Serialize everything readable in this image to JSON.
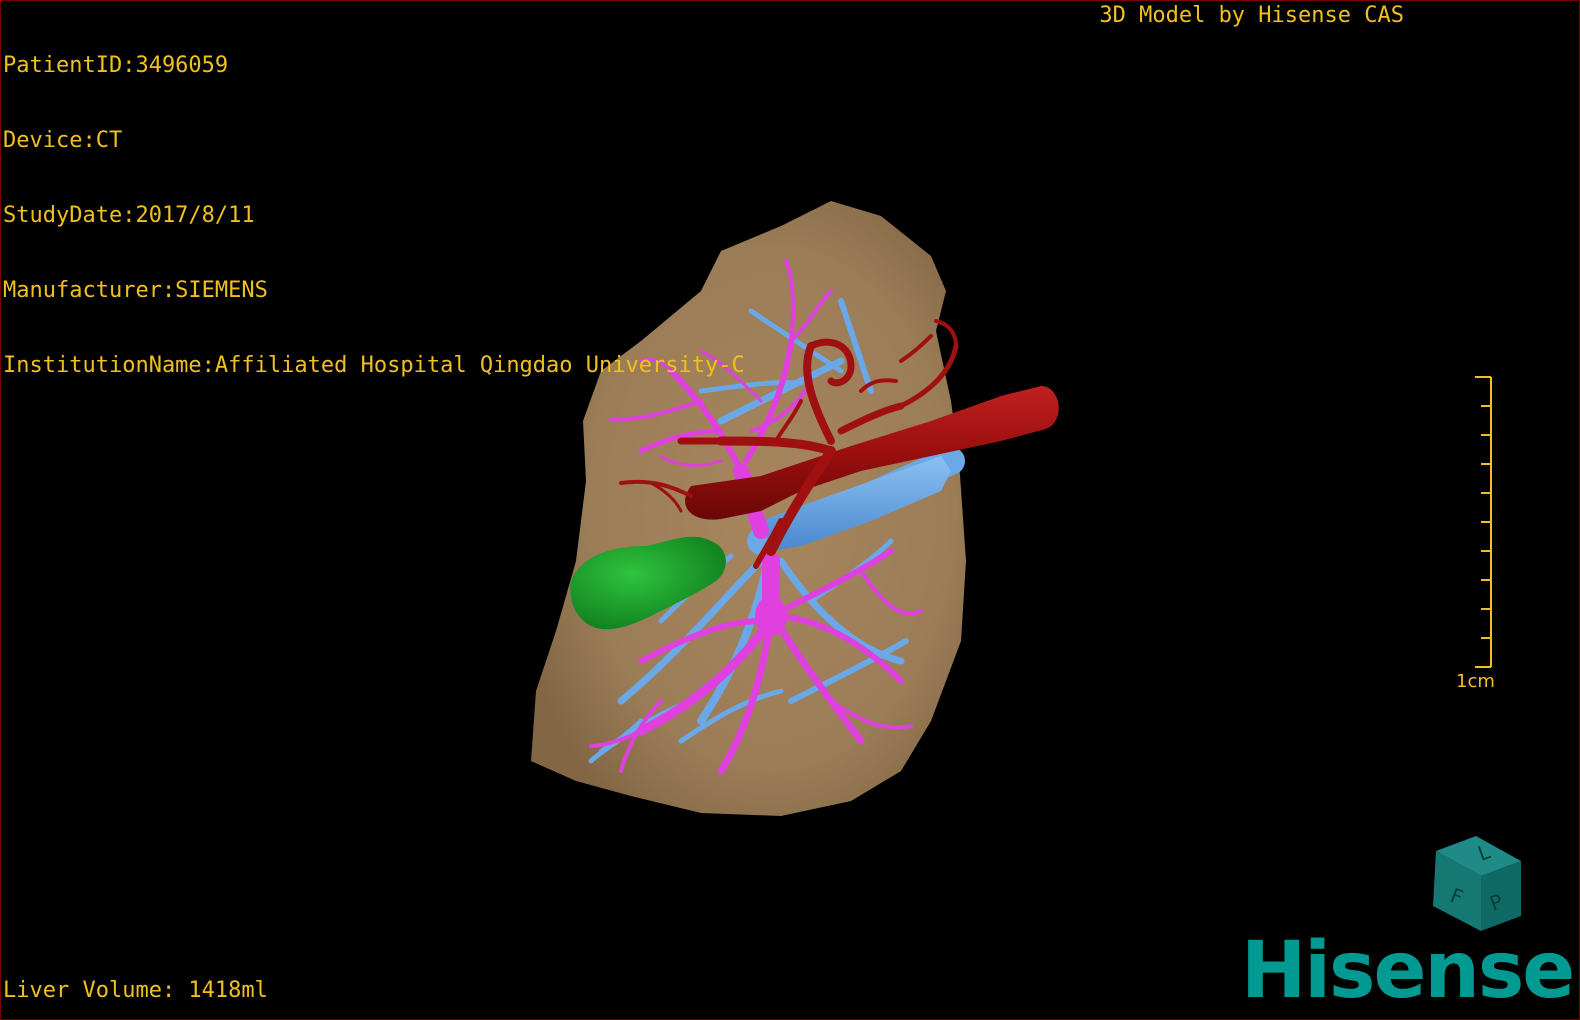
{
  "header": {
    "patient_id": "PatientID:3496059",
    "device": "Device:CT",
    "study_date": "StudyDate:2017/8/11",
    "manufacturer": "Manufacturer:SIEMENS",
    "institution": "InstitutionName:Affiliated Hospital Qingdao University-C"
  },
  "title": "3D Model by Hisense CAS",
  "footer": {
    "liver_volume": "Liver Volume: 1418ml"
  },
  "scale": {
    "label": "1cm"
  },
  "orientation_cube": {
    "face_left": "F",
    "face_right": "P",
    "face_top": "L"
  },
  "brand": {
    "logo_text": "Hisense"
  },
  "colors": {
    "overlay_text": "#f0c020",
    "liver": "#a3835c",
    "hepatic_vein": "#e040e0",
    "portal_vein": "#6aa8e8",
    "artery_ivc": "#a01010",
    "gallbladder": "#1aa02a",
    "brand": "#009a93"
  }
}
